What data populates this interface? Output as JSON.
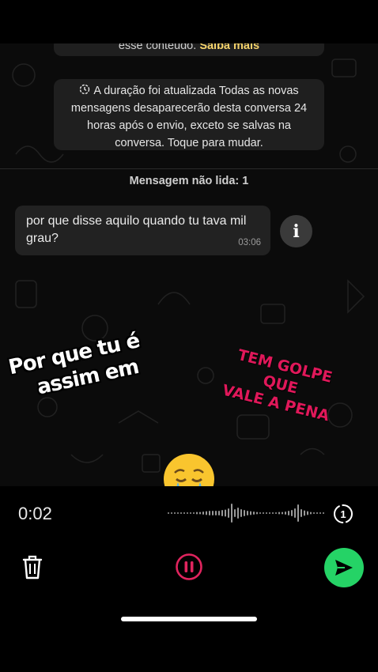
{
  "system_top": {
    "text": "esse conteúdo.",
    "link": "Saiba mais"
  },
  "system_notice": {
    "icon": "timer-icon",
    "text": "A duração foi atualizada Todas as novas mensagens desaparecerão desta conversa 24 horas após o envio, exceto se salvas na conversa. Toque para mudar."
  },
  "unread_label": "Mensagem não lida: 1",
  "message": {
    "text": "por que disse aquilo quando tu tava mil grau?",
    "time": "03:06"
  },
  "info_button": {
    "label": "i"
  },
  "sticker_left": {
    "lines": [
      "Por que tu é",
      "assim em"
    ]
  },
  "sticker_right": {
    "lines": [
      "TEM GOLPE",
      "QUE",
      "VALE A PENA"
    ]
  },
  "emoji": {
    "name": "crying-face-emoji"
  },
  "recording": {
    "elapsed": "0:02",
    "view_once_label": "1"
  },
  "colors": {
    "accent_green": "#25d366",
    "pause_red": "#e0245e",
    "sticker_pink": "#e0185a",
    "link_yellow": "#f5d36b"
  }
}
